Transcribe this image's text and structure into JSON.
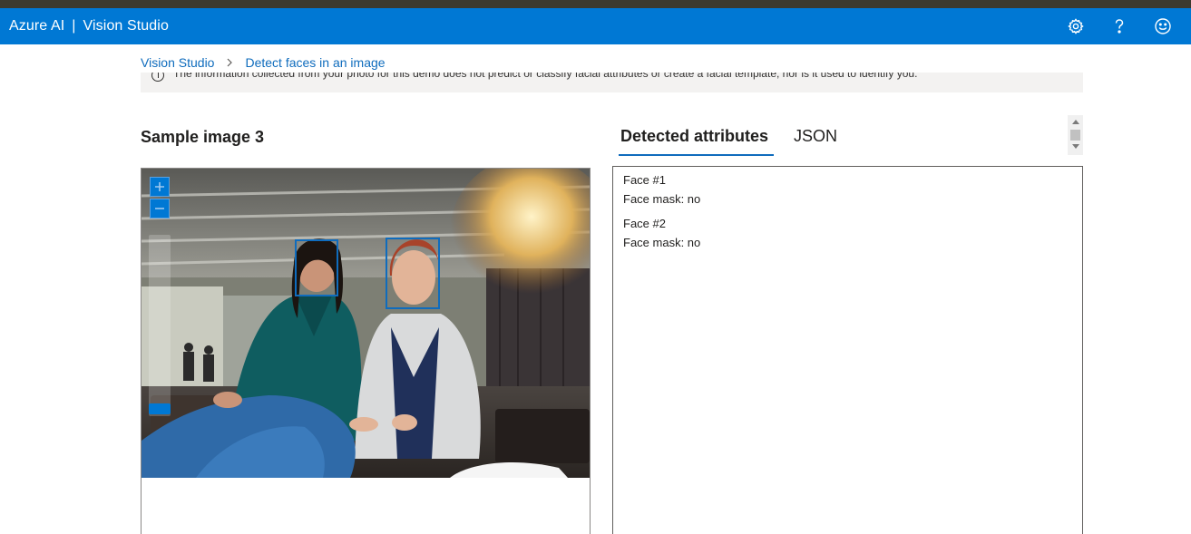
{
  "header": {
    "app_name": "Azure AI",
    "separator": "|",
    "product": "Vision Studio",
    "icons": [
      "gear-icon",
      "help-icon",
      "feedback-smiley-icon"
    ],
    "color": "#0078d4"
  },
  "breadcrumb": {
    "home": "Vision Studio",
    "current": "Detect faces in an image"
  },
  "notice": {
    "text": "The information collected from your photo for this demo does not predict or classify facial attributes or create a facial template, nor is it used to identify you."
  },
  "sample": {
    "title": "Sample image 3",
    "zoom_in_icon": "plus-icon",
    "zoom_out_icon": "minus-icon"
  },
  "tabs": [
    {
      "label": "Detected attributes",
      "active": true
    },
    {
      "label": "JSON",
      "active": false
    }
  ],
  "faces": [
    {
      "label": "Face #1",
      "mask": "Face mask: no"
    },
    {
      "label": "Face #2",
      "mask": "Face mask: no"
    }
  ],
  "colors": {
    "accent": "#0f6cbd",
    "face_box": "#0f6cbd"
  }
}
